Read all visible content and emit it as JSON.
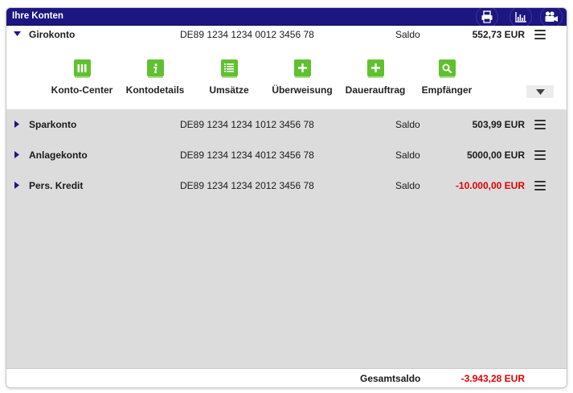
{
  "header": {
    "title": "Ihre Konten",
    "buttons": [
      {
        "icon": "print-icon"
      },
      {
        "icon": "chart-icon"
      },
      {
        "icon": "video-icon"
      }
    ]
  },
  "accounts": [
    {
      "name": "Girokonto",
      "iban": "DE89 1234 1234 0012 3456 78",
      "saldo_label": "Saldo",
      "amount": "552,73 EUR",
      "negative": false,
      "expanded": true
    },
    {
      "name": "Sparkonto",
      "iban": "DE89 1234 1234 1012 3456 78",
      "saldo_label": "Saldo",
      "amount": "503,99 EUR",
      "negative": false,
      "expanded": false
    },
    {
      "name": "Anlagekonto",
      "iban": "DE89 1234 1234 4012 3456 78",
      "saldo_label": "Saldo",
      "amount": "5000,00 EUR",
      "negative": false,
      "expanded": false
    },
    {
      "name": "Pers. Kredit",
      "iban": "DE89 1234 1234 2012 3456 78",
      "saldo_label": "Saldo",
      "amount": "-10.000,00 EUR",
      "negative": true,
      "expanded": false
    }
  ],
  "actions": [
    {
      "label": "Konto-Center",
      "icon": "columns-icon"
    },
    {
      "label": "Kontodetails",
      "icon": "info-icon"
    },
    {
      "label": "Umsätze",
      "icon": "list-icon"
    },
    {
      "label": "Überweisung",
      "icon": "plus-icon"
    },
    {
      "label": "Dauerauftrag",
      "icon": "plus-icon"
    },
    {
      "label": "Empfänger",
      "icon": "search-icon"
    }
  ],
  "footer": {
    "label": "Gesamtsaldo",
    "amount": "-3.943,28 EUR"
  },
  "colors": {
    "header_bg": "#1c1680",
    "action_green": "#5fc12f",
    "negative_red": "#e00000",
    "list_bg": "#dcdcdc"
  }
}
